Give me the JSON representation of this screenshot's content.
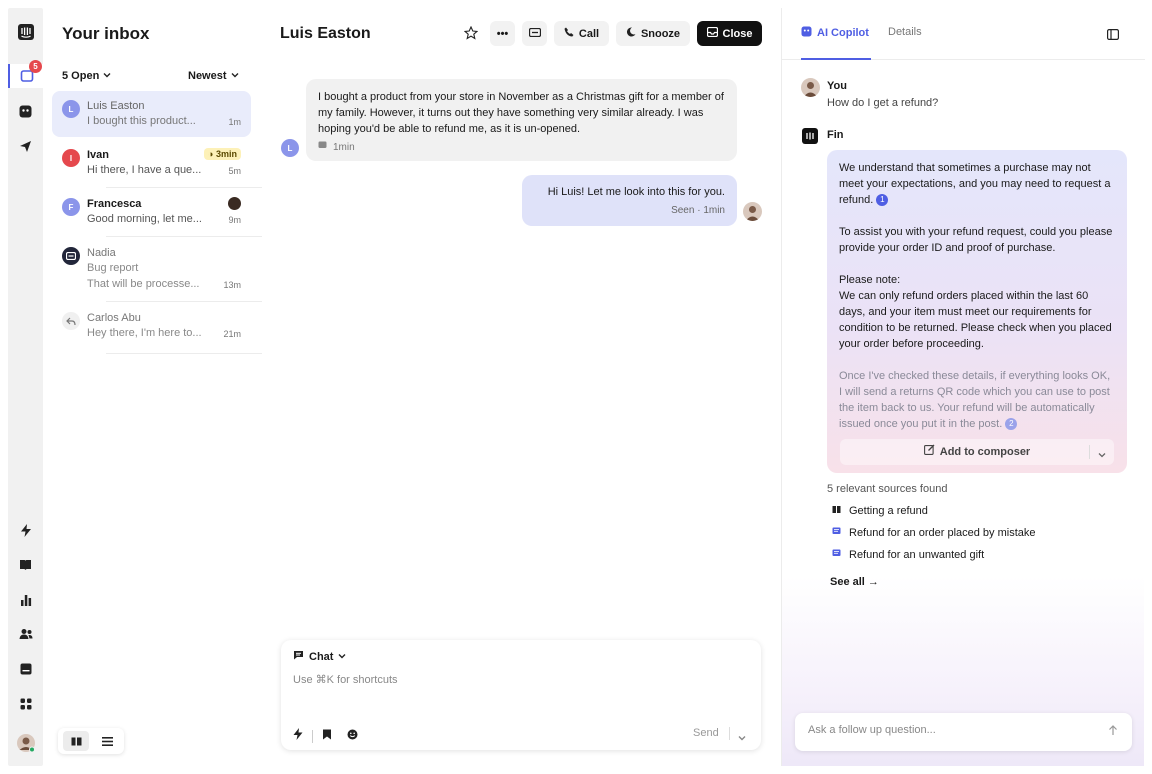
{
  "rail": {
    "inbox_badge": "5"
  },
  "inbox": {
    "title": "Your inbox",
    "filter_open": "5 Open",
    "sort": "Newest",
    "conversations": [
      {
        "initial": "L",
        "name": "Luis Easton",
        "snippet": "I bought this product...",
        "time": "1m"
      },
      {
        "initial": "I",
        "name": "Ivan",
        "snippet": "Hi there, I have a que...",
        "time": "5m",
        "tag": "3min"
      },
      {
        "initial": "F",
        "name": "Francesca",
        "snippet": "Good morning, let me...",
        "time": "9m"
      },
      {
        "name": "Nadia",
        "subject": "Bug report",
        "snippet": "That will be processe...",
        "time": "13m"
      },
      {
        "name": "Carlos Abu",
        "snippet": "Hey there, I'm here to...",
        "time": "21m"
      }
    ]
  },
  "conversation": {
    "title": "Luis Easton",
    "call_label": "Call",
    "snooze_label": "Snooze",
    "close_label": "Close",
    "avatar_initial": "L",
    "messages": [
      {
        "text": "I bought a product from your store in November as a Christmas gift for a member of my family. However, it turns out they have something very similar already. I was hoping you'd be able to refund me, as it is un-opened.",
        "meta": "1min"
      },
      {
        "text": "Hi Luis! Let me look into this for you.",
        "meta": "Seen · 1min"
      }
    ],
    "composer": {
      "channel": "Chat",
      "placeholder": "Use ⌘K for shortcuts",
      "send_label": "Send"
    }
  },
  "copilot": {
    "tab_active": "AI Copilot",
    "tab_details": "Details",
    "question_author": "You",
    "question": "How do I get a refund?",
    "bot_name": "Fin",
    "answer": {
      "p1": "We understand that sometimes a purchase may not meet your expectations, and you may need to request a refund.",
      "cite1": "1",
      "p2": "To assist you with your refund request, could you please provide your order ID and proof of purchase.",
      "p3_title": "Please note:",
      "p3": "We can only refund orders placed within the last 60 days, and your item must meet our requirements for condition to be returned. Please check when you placed your order before proceeding.",
      "p4": "Once I've checked these details, if everything looks OK, I will send a returns QR code which you can use to post the item back to us. Your refund will be automatically issued once you put it in the post.",
      "cite2": "2",
      "add_to_composer": "Add to composer"
    },
    "sources_count": "5 relevant sources found",
    "sources": [
      "Getting a refund",
      "Refund for an order placed by mistake",
      "Refund for an unwanted gift"
    ],
    "see_all": "See all →",
    "ask_placeholder": "Ask a follow up question..."
  },
  "colors": {
    "accent": "#4f5ee3",
    "badge": "#e5484d",
    "tag_bg": "#fdf1b8"
  }
}
